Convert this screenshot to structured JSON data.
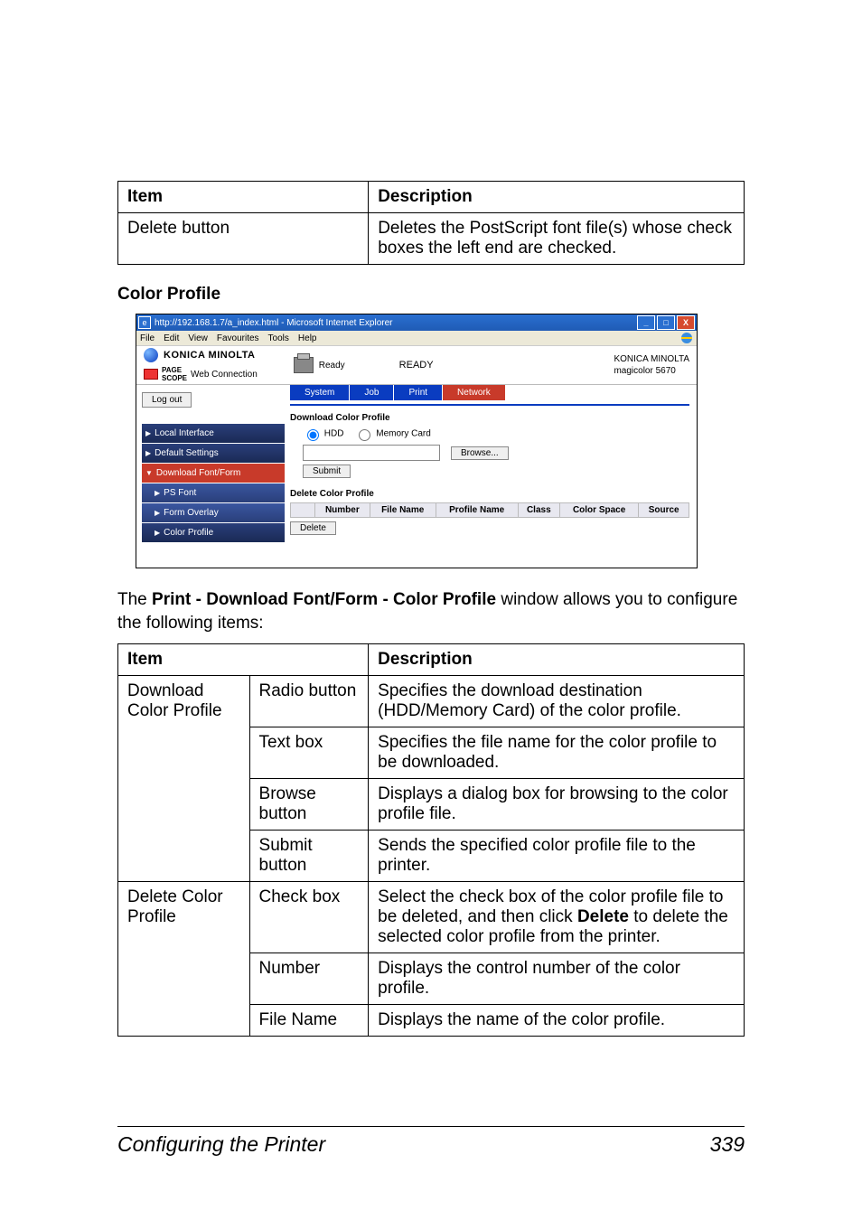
{
  "table1": {
    "headers": [
      "Item",
      "Description"
    ],
    "row": {
      "item": "Delete button",
      "desc": "Deletes the PostScript font file(s) whose check boxes the left end are checked."
    }
  },
  "sectionHeading": "Color Profile",
  "screenshot": {
    "title": "http://192.168.1.7/a_index.html - Microsoft Internet Explorer",
    "menu": [
      "File",
      "Edit",
      "View",
      "Favourites",
      "Tools",
      "Help"
    ],
    "brand": "KONICA MINOLTA",
    "pagescope": "Web Connection",
    "readyIcon": "Ready",
    "readyStatus": "READY",
    "rightBrand": "KONICA MINOLTA",
    "rightModel": "magicolor 5670",
    "logout": "Log out",
    "tabs": [
      "System",
      "Job",
      "Print",
      "Network"
    ],
    "side": {
      "local": "Local Interface",
      "default": "Default Settings",
      "download": "Download Font/Form",
      "psfont": "PS Font",
      "formoverlay": "Form Overlay",
      "colorprofile": "Color Profile"
    },
    "panel": {
      "dlTitle": "Download Color Profile",
      "hdd": "HDD",
      "mem": "Memory Card",
      "browse": "Browse...",
      "submit": "Submit",
      "delTitle": "Delete Color Profile",
      "cols": [
        "Number",
        "File Name",
        "Profile Name",
        "Class",
        "Color Space",
        "Source"
      ],
      "delete": "Delete"
    }
  },
  "bodyText": {
    "pre": "The ",
    "bold": "Print - Download Font/Form - Color Profile",
    "post": " window allows you to configure the following items:"
  },
  "table2": {
    "headers": [
      "Item",
      "Description"
    ],
    "rows": [
      {
        "g": "Download Color Profile",
        "c": "Radio button",
        "d": "Specifies the download destination (HDD/Memory Card) of the color profile."
      },
      {
        "g": "",
        "c": "Text box",
        "d": "Specifies the file name for the color profile to be downloaded."
      },
      {
        "g": "",
        "c": "Browse button",
        "d": "Displays a dialog box for browsing to the color profile file."
      },
      {
        "g": "",
        "c": "Submit button",
        "d": "Sends the specified color profile file to the printer."
      },
      {
        "g": "Delete Color Profile",
        "c": "Check box",
        "d": "Select the check box of the color profile file to be deleted, and then click <b>Delete</b> to delete the selected color profile from the printer."
      },
      {
        "g": "",
        "c": "Number",
        "d": "Displays the control number of the color profile."
      },
      {
        "g": "",
        "c": "File Name",
        "d": "Displays the name of the color profile."
      }
    ]
  },
  "footer": {
    "title": "Configuring the Printer",
    "page": "339"
  }
}
